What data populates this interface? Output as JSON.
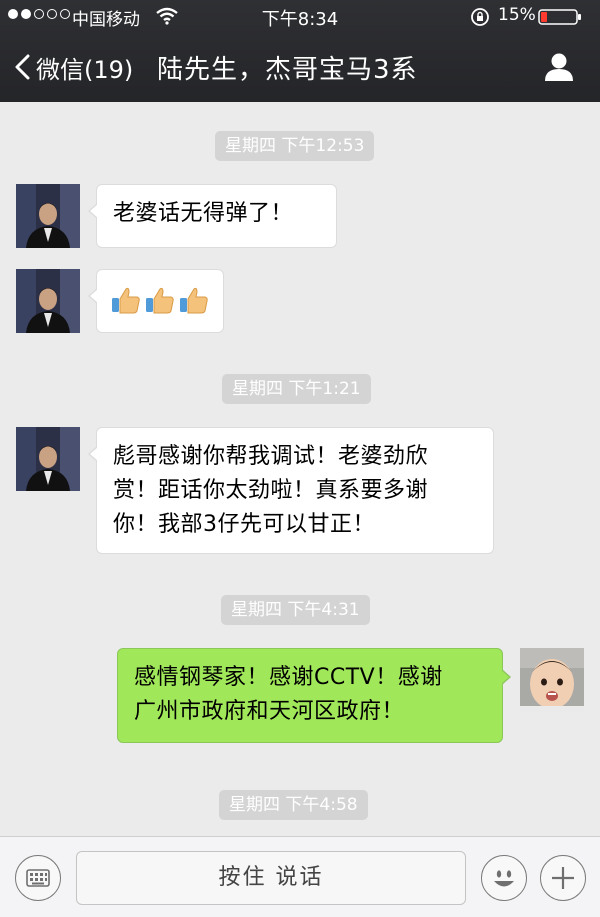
{
  "status_bar": {
    "carrier": "中国移动",
    "time": "下午8:34",
    "battery": "15%",
    "battery_color": "#ff3b30",
    "icons": [
      "signal-dots",
      "wifi-icon",
      "rotation-lock-icon",
      "battery-icon"
    ]
  },
  "nav": {
    "back_label": "微信(19)",
    "title": "陆先生，杰哥宝马3系",
    "icons": [
      "chevron-left-icon",
      "person-icon"
    ]
  },
  "messages": [
    {
      "type": "time",
      "text": "星期四 下午12:53"
    },
    {
      "type": "in",
      "sender": "陆先生",
      "text": "老婆话无得弹了！"
    },
    {
      "type": "in",
      "sender": "陆先生",
      "emoji": [
        "thumbs-up",
        "thumbs-up",
        "thumbs-up"
      ]
    },
    {
      "type": "time",
      "text": "星期四 下午1:21"
    },
    {
      "type": "in",
      "sender": "陆先生",
      "lines": [
        "彪哥感谢你帮我调试！老婆劲欣",
        "赏！距话你太劲啦！真系要多谢",
        "你！我部3仔先可以甘正！"
      ]
    },
    {
      "type": "time",
      "text": "星期四 下午4:31"
    },
    {
      "type": "out",
      "sender": "me",
      "lines": [
        "感情钢琴家！感谢CCTV！感谢",
        "广州市政府和天河区政府！"
      ]
    },
    {
      "type": "time",
      "text": "星期四 下午4:58"
    }
  ],
  "input_bar": {
    "hold_to_talk": "按住 说话",
    "icons": [
      "keyboard-icon",
      "emoji-icon",
      "plus-icon"
    ]
  },
  "colors": {
    "header_bg": "#2a2b2e",
    "chat_bg": "#ebebeb",
    "outgoing_bubble": "#a0e75a",
    "incoming_bubble": "#ffffff",
    "timestamp_bg": "#d4d4d4"
  }
}
